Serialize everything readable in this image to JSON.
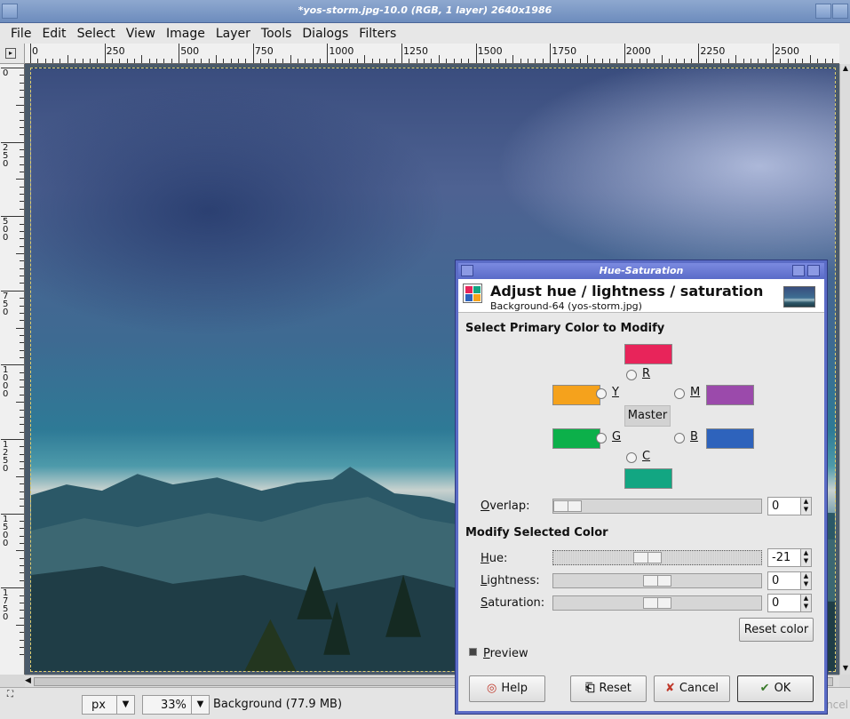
{
  "window": {
    "title": "*yos-storm.jpg-10.0 (RGB, 1 layer) 2640x1986"
  },
  "menu": [
    "File",
    "Edit",
    "Select",
    "View",
    "Image",
    "Layer",
    "Tools",
    "Dialogs",
    "Filters"
  ],
  "ruler": {
    "h_labels": [
      "0",
      "250",
      "500",
      "750",
      "1000",
      "1250",
      "1500",
      "1750",
      "2000",
      "2250",
      "2500"
    ],
    "v_labels": [
      "0",
      "250",
      "500",
      "750",
      "1000",
      "1250",
      "1500",
      "1750"
    ]
  },
  "status": {
    "unit": "px",
    "zoom": "33%",
    "message": "Background (77.9 MB)",
    "cancel": "ncel"
  },
  "dialog": {
    "window_title": "Hue-Saturation",
    "header_title": "Adjust hue / lightness / saturation",
    "header_subtitle": "Background-64 (yos-storm.jpg)",
    "section_primary": "Select Primary Color to Modify",
    "colors": {
      "R": {
        "label": "R",
        "swatch": "#e8245a"
      },
      "Y": {
        "label": "Y",
        "swatch": "#f5a21c"
      },
      "M": {
        "label": "M",
        "swatch": "#9b4aab"
      },
      "G": {
        "label": "G",
        "swatch": "#0cb04a"
      },
      "B": {
        "label": "B",
        "swatch": "#2e63bc"
      },
      "C": {
        "label": "C",
        "swatch": "#12a682"
      }
    },
    "master_label": "Master",
    "overlap": {
      "label": "Overlap:",
      "value": "0"
    },
    "section_modify": "Modify Selected Color",
    "hue": {
      "label": "Hue:",
      "value": "-21"
    },
    "lightness": {
      "label": "Lightness:",
      "value": "0"
    },
    "saturation": {
      "label": "Saturation:",
      "value": "0"
    },
    "reset_color": "Reset color",
    "preview": "Preview",
    "preview_checked": true,
    "buttons": {
      "help": "Help",
      "reset": "Reset",
      "cancel": "Cancel",
      "ok": "OK"
    }
  }
}
